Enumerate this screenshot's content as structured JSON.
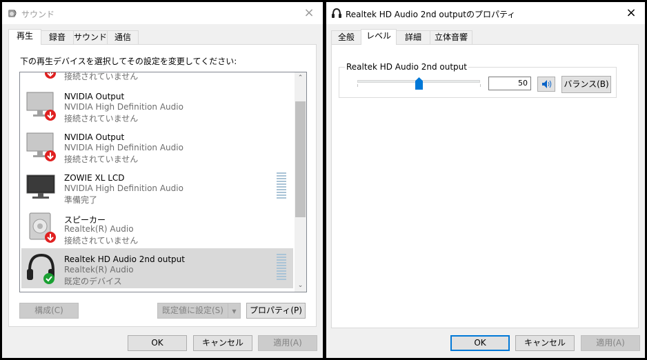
{
  "left_window": {
    "title": "サウンド",
    "tabs": [
      "再生",
      "録音",
      "サウンド",
      "通信"
    ],
    "instruction": "下の再生デバイスを選択してその設定を変更してください:",
    "partial_top_status": "接続されていません",
    "devices": [
      {
        "name": "NVIDIA Output",
        "description": "NVIDIA High Definition Audio",
        "status": "接続されていません",
        "icon": "monitor-disconnected-icon"
      },
      {
        "name": "NVIDIA Output",
        "description": "NVIDIA High Definition Audio",
        "status": "接続されていません",
        "icon": "monitor-disconnected-icon"
      },
      {
        "name": "ZOWIE XL LCD",
        "description": "NVIDIA High Definition Audio",
        "status": "準備完了",
        "icon": "monitor-icon"
      },
      {
        "name": "スピーカー",
        "description": "Realtek(R) Audio",
        "status": "接続されていません",
        "icon": "speaker-disconnected-icon"
      },
      {
        "name": "Realtek HD Audio 2nd output",
        "description": "Realtek(R) Audio",
        "status": "既定のデバイス",
        "icon": "headphones-default-icon"
      }
    ],
    "buttons": {
      "configure": "構成(C)",
      "set_default": "既定値に設定(S)",
      "properties": "プロパティ(P)",
      "ok": "OK",
      "cancel": "キャンセル",
      "apply": "適用(A)"
    }
  },
  "right_window": {
    "title": "Realtek HD Audio 2nd outputのプロパティ",
    "tabs": [
      "全般",
      "レベル",
      "詳細",
      "立体音響"
    ],
    "level_group": {
      "label": "Realtek HD Audio 2nd output",
      "value": "50",
      "balance_button": "バランス(B)"
    },
    "buttons": {
      "ok": "OK",
      "cancel": "キャンセル",
      "apply": "適用(A)"
    }
  },
  "colors": {
    "accent": "#0078d7",
    "disconnected_badge": "#e02020",
    "default_badge": "#1aa032",
    "selected_row": "#d9d9d9"
  }
}
